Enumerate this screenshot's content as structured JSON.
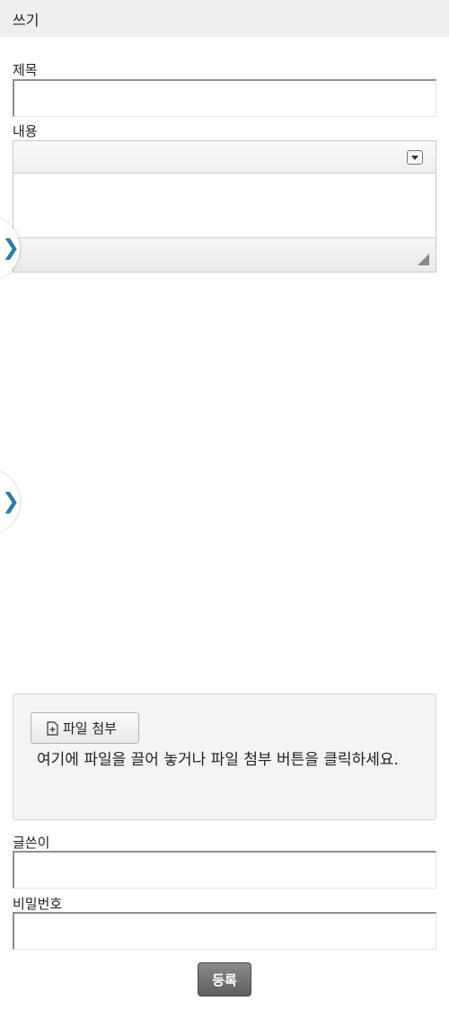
{
  "header": {
    "title": "쓰기"
  },
  "form": {
    "title_label": "제목",
    "title_value": "",
    "content_label": "내용",
    "author_label": "글쓴이",
    "author_value": "",
    "password_label": "비밀번호",
    "password_value": ""
  },
  "editor": {
    "toolbar_toggle_icon": "chevron-down-icon",
    "resize_icon": "resize-grip-icon"
  },
  "attachment": {
    "button_label": "파일 첨부",
    "button_icon": "file-plus-icon",
    "hint": "여기에 파일을 끌어 놓거나 파일 첨부 버튼을 클릭하세요."
  },
  "side_tabs": [
    {
      "icon": "chevron-right-icon",
      "glyph": "❯"
    },
    {
      "icon": "chevron-right-icon",
      "glyph": "❯"
    }
  ],
  "actions": {
    "submit_label": "등록"
  },
  "colors": {
    "header_bg": "#efefef",
    "accent": "#2b7ea1",
    "submit_bg": "#6f6f6f"
  }
}
